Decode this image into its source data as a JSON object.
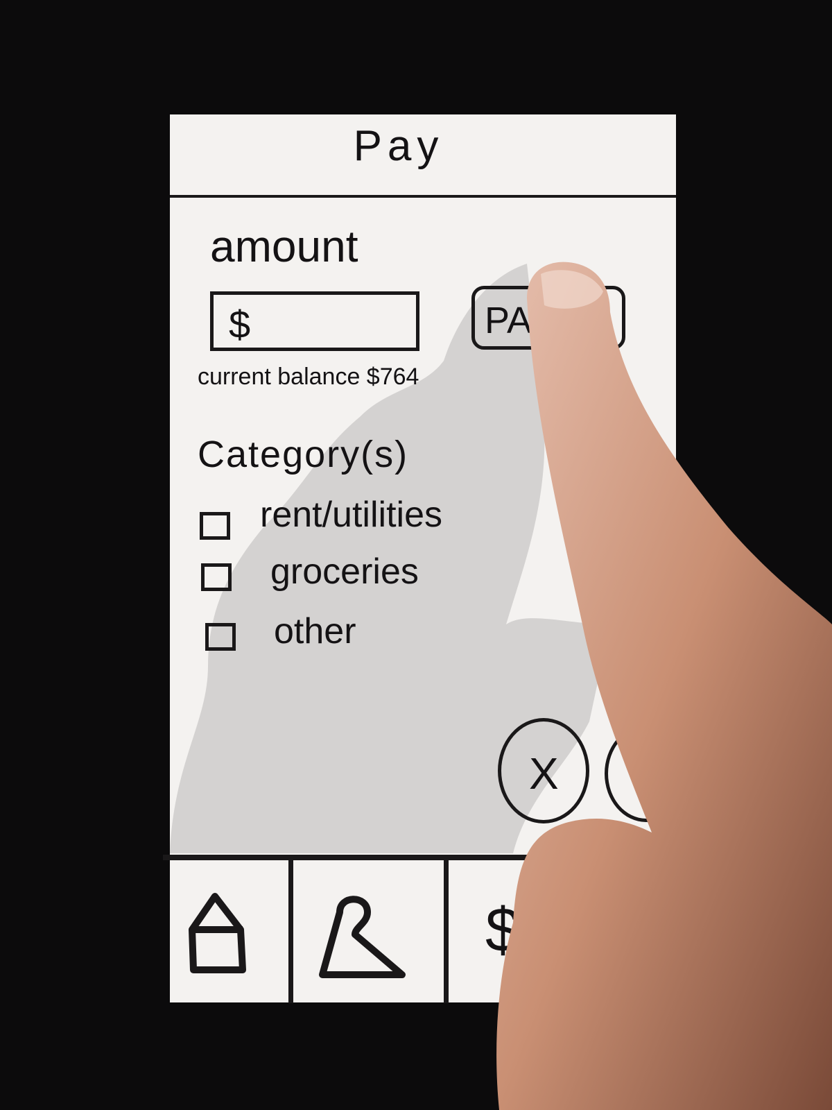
{
  "header": {
    "title": "Pay"
  },
  "form": {
    "amount_label": "amount",
    "amount_prefix": "$",
    "pay_button_label": "PA",
    "balance_text": "current balance $764"
  },
  "categories": {
    "label": "Category(s)",
    "items": [
      {
        "label": "rent/utilities",
        "checked": false
      },
      {
        "label": "groceries",
        "checked": false
      },
      {
        "label": "other",
        "checked": false
      }
    ]
  },
  "actions": {
    "cancel_label": "X"
  },
  "bottom_nav": [
    {
      "icon": "home-icon"
    },
    {
      "icon": "hanger-icon"
    },
    {
      "icon": "dollar-icon",
      "label": "$"
    }
  ],
  "colors": {
    "ink": "#1a1819",
    "paper": "#f4f2f0",
    "background": "#0c0b0c"
  }
}
